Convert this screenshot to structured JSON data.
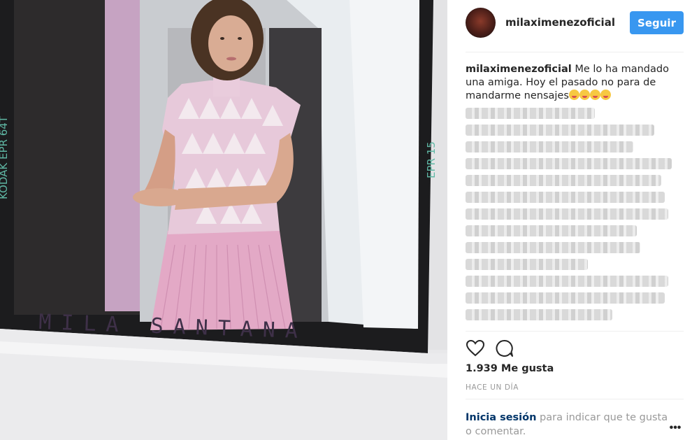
{
  "post": {
    "username": "milaximenezoficial",
    "follow_label": "Seguir",
    "caption_user": "milaximenezoficial",
    "caption_text": " Me lo ha mandado una amiga. Hoy el pasado no para de mandarme nensajes",
    "likes": "1.939 Me gusta",
    "time_ago": "HACE UN DÍA",
    "login_link": "Inicia sesión",
    "login_text": " para indicar que te gusta o comentar.",
    "more_label": "•••"
  },
  "photo": {
    "handwriting": "MILA   SANTANA",
    "film_left": "KODAK EPR 64T",
    "film_right": "EPR 15"
  },
  "icons": {
    "like": "heart-icon",
    "comment": "speech-bubble-icon",
    "more": "ellipsis-icon",
    "emoji": "face-emoji"
  },
  "colors": {
    "follow_button": "#3897f0",
    "login_link": "#003569",
    "muted_text": "#999999"
  }
}
